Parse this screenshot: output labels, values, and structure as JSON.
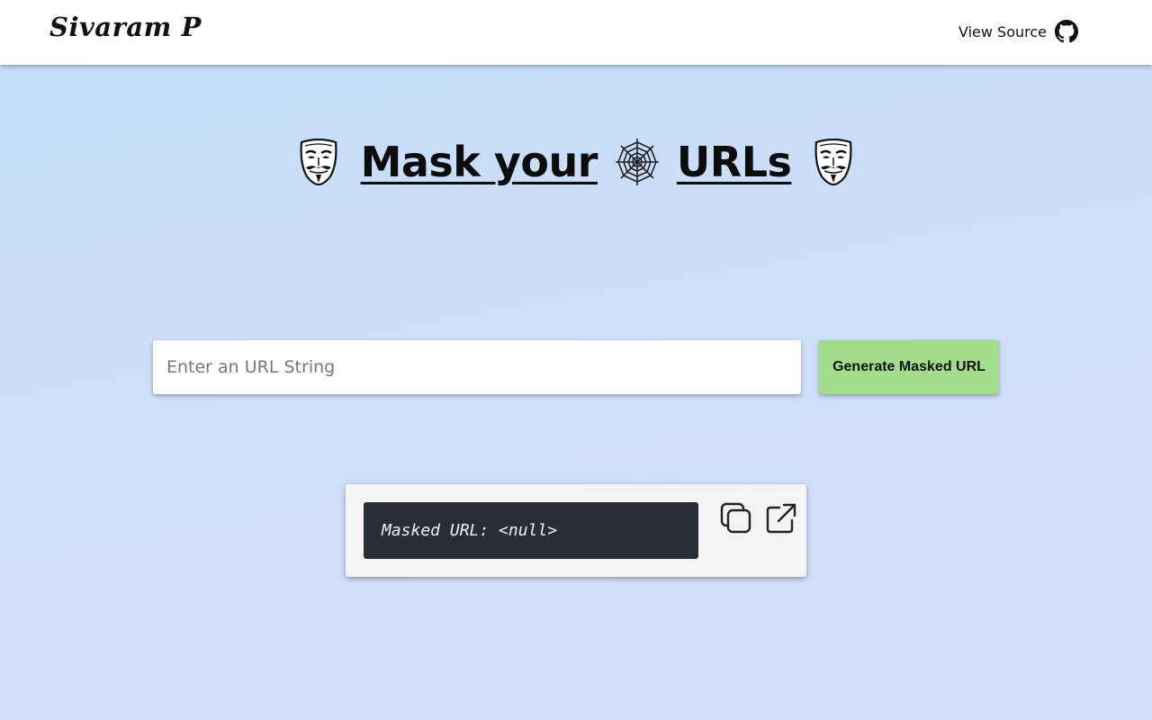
{
  "navbar": {
    "brand": "Sivaram P",
    "view_source_label": "View Source",
    "github_icon": "github-icon"
  },
  "hero": {
    "title_part1": "Mask your",
    "title_part2": "URLs",
    "left_icon": "guy-fawkes-mask-icon",
    "middle_icon": "spider-web-icon",
    "right_icon": "guy-fawkes-mask-icon"
  },
  "form": {
    "input_value": "",
    "input_placeholder": "Enter an URL String",
    "generate_label": "Generate Masked URL",
    "generate_color": "#a1dd8b"
  },
  "result": {
    "masked_text": "Masked URL: <null>",
    "copy_icon": "copy-icon",
    "open_icon": "external-link-icon"
  },
  "colors": {
    "background_top": "#c3ddf9",
    "background_bottom": "#d3defc",
    "output_background": "#272e35",
    "card_background": "#f3f3f3"
  }
}
